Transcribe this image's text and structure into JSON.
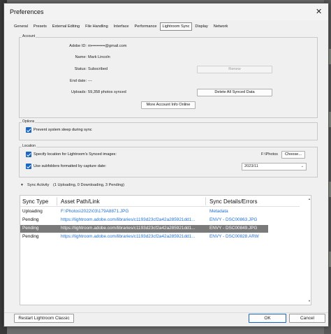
{
  "window": {
    "title": "Preferences",
    "close_glyph": "✕"
  },
  "tabs": [
    "General",
    "Presets",
    "External Editing",
    "File Handling",
    "Interface",
    "Performance",
    "Lightroom Sync",
    "Display",
    "Network"
  ],
  "account": {
    "group_label": "Account",
    "adobe_id_label": "Adobe ID:",
    "adobe_id_value": "m••••••••••@gmail.com",
    "name_label": "Name:",
    "name_value": "Mark Lincoln",
    "status_label": "Status:",
    "status_value": "Subscribed",
    "end_date_label": "End date:",
    "end_date_value": "---",
    "uploads_label": "Uploads:",
    "uploads_value": "59,358 photos synced",
    "renew_button": "Renew",
    "delete_button": "Delete All Synced Data",
    "more_info_button": "More Account Info Online"
  },
  "options": {
    "group_label": "Options",
    "prevent_sleep_label": "Prevent system sleep during sync",
    "prevent_sleep_checked": true
  },
  "location": {
    "group_label": "Location",
    "specify_location_label": "Specify location for Lightroom's Synced images:",
    "specify_location_checked": true,
    "path_value": "F:\\Photos",
    "choose_button": "Choose...",
    "subfolders_label": "Use subfolders formatted by capture date:",
    "subfolders_checked": true,
    "date_format_value": "2023/11",
    "chevron": "⌄"
  },
  "sync_activity": {
    "header": "Sync Activity",
    "summary": "(1 Uploading, 0 Downloading, 3 Pending)",
    "triangle": "▼",
    "columns": [
      "Sync Type",
      "Asset Path/Link",
      "Sync Details/Errors"
    ],
    "rows": [
      {
        "type": "Uploading",
        "path": "F:\\Photos\\2022\\03\\179A8871.JPG",
        "details": "Metadata",
        "selected": false
      },
      {
        "type": "Pending",
        "path": "https://lightroom.adobe.com/libraries/c1193d23cf2a42a285921dd1...",
        "details": "ENVY - DSC00863.JPG",
        "selected": false
      },
      {
        "type": "Pending",
        "path": "https://lightroom.adobe.com/libraries/c1193d23cf2a42a285921dd1...",
        "details": "ENVY - DSC00849.JPG",
        "selected": true
      },
      {
        "type": "Pending",
        "path": "https://lightroom.adobe.com/libraries/c1193d23cf2a42a285921dd1...",
        "details": "ENVY - DSC00828.ARW",
        "selected": false
      }
    ]
  },
  "footer": {
    "restart_button": "Restart Lightroom Classic",
    "ok_button": "OK",
    "cancel_button": "Cancel"
  }
}
